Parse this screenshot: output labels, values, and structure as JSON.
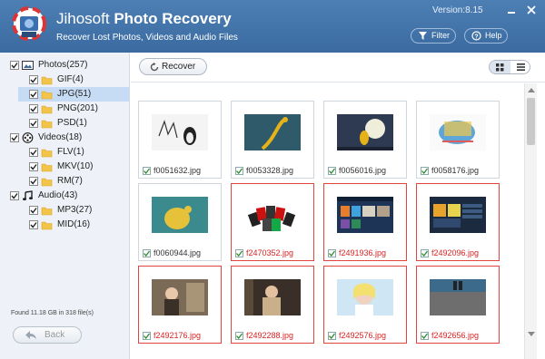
{
  "header": {
    "brand": "Jihosoft",
    "product": "Photo Recovery",
    "subtitle": "Recover Lost Photos, Videos and Audio Files",
    "version": "Version:8.15",
    "filter_label": "Filter",
    "help_label": "Help"
  },
  "sidebar": {
    "tree": [
      {
        "label": "Photos(257)",
        "level": 0,
        "icon": "photo-icon",
        "checked": true,
        "selected": false
      },
      {
        "label": "GIF(4)",
        "level": 1,
        "icon": "folder-icon",
        "checked": true,
        "selected": false
      },
      {
        "label": "JPG(51)",
        "level": 1,
        "icon": "folder-icon",
        "checked": true,
        "selected": true
      },
      {
        "label": "PNG(201)",
        "level": 1,
        "icon": "folder-icon",
        "checked": true,
        "selected": false
      },
      {
        "label": "PSD(1)",
        "level": 1,
        "icon": "folder-icon",
        "checked": true,
        "selected": false
      },
      {
        "label": "Videos(18)",
        "level": 0,
        "icon": "video-reel-icon",
        "checked": true,
        "selected": false
      },
      {
        "label": "FLV(1)",
        "level": 1,
        "icon": "folder-icon",
        "checked": true,
        "selected": false
      },
      {
        "label": "MKV(10)",
        "level": 1,
        "icon": "folder-icon",
        "checked": true,
        "selected": false
      },
      {
        "label": "RM(7)",
        "level": 1,
        "icon": "folder-icon",
        "checked": true,
        "selected": false
      },
      {
        "label": "Audio(43)",
        "level": 0,
        "icon": "music-note-icon",
        "checked": true,
        "selected": false
      },
      {
        "label": "MP3(27)",
        "level": 1,
        "icon": "folder-icon",
        "checked": true,
        "selected": false
      },
      {
        "label": "MID(16)",
        "level": 1,
        "icon": "folder-icon",
        "checked": true,
        "selected": false
      }
    ],
    "found_text": "Found 11.18 GB in 318 file(s)",
    "back_label": "Back"
  },
  "toolbar": {
    "recover_label": "Recover"
  },
  "files": [
    {
      "name": "f0051632.jpg",
      "flagged": false
    },
    {
      "name": "f0053328.jpg",
      "flagged": false
    },
    {
      "name": "f0056016.jpg",
      "flagged": false
    },
    {
      "name": "f0058176.jpg",
      "flagged": false
    },
    {
      "name": "f0060944.jpg",
      "flagged": false
    },
    {
      "name": "f2470352.jpg",
      "flagged": true
    },
    {
      "name": "f2491936.jpg",
      "flagged": true
    },
    {
      "name": "f2492096.jpg",
      "flagged": true
    },
    {
      "name": "f2492176.jpg",
      "flagged": true
    },
    {
      "name": "f2492288.jpg",
      "flagged": true
    },
    {
      "name": "f2492576.jpg",
      "flagged": true
    },
    {
      "name": "f2492656.jpg",
      "flagged": true
    }
  ],
  "colors": {
    "header_top": "#4d7fb5",
    "header_bottom": "#3a6aa0",
    "selection": "#c6dcf5",
    "flagged_border": "#e0463e",
    "flagged_text": "#dd2222"
  }
}
